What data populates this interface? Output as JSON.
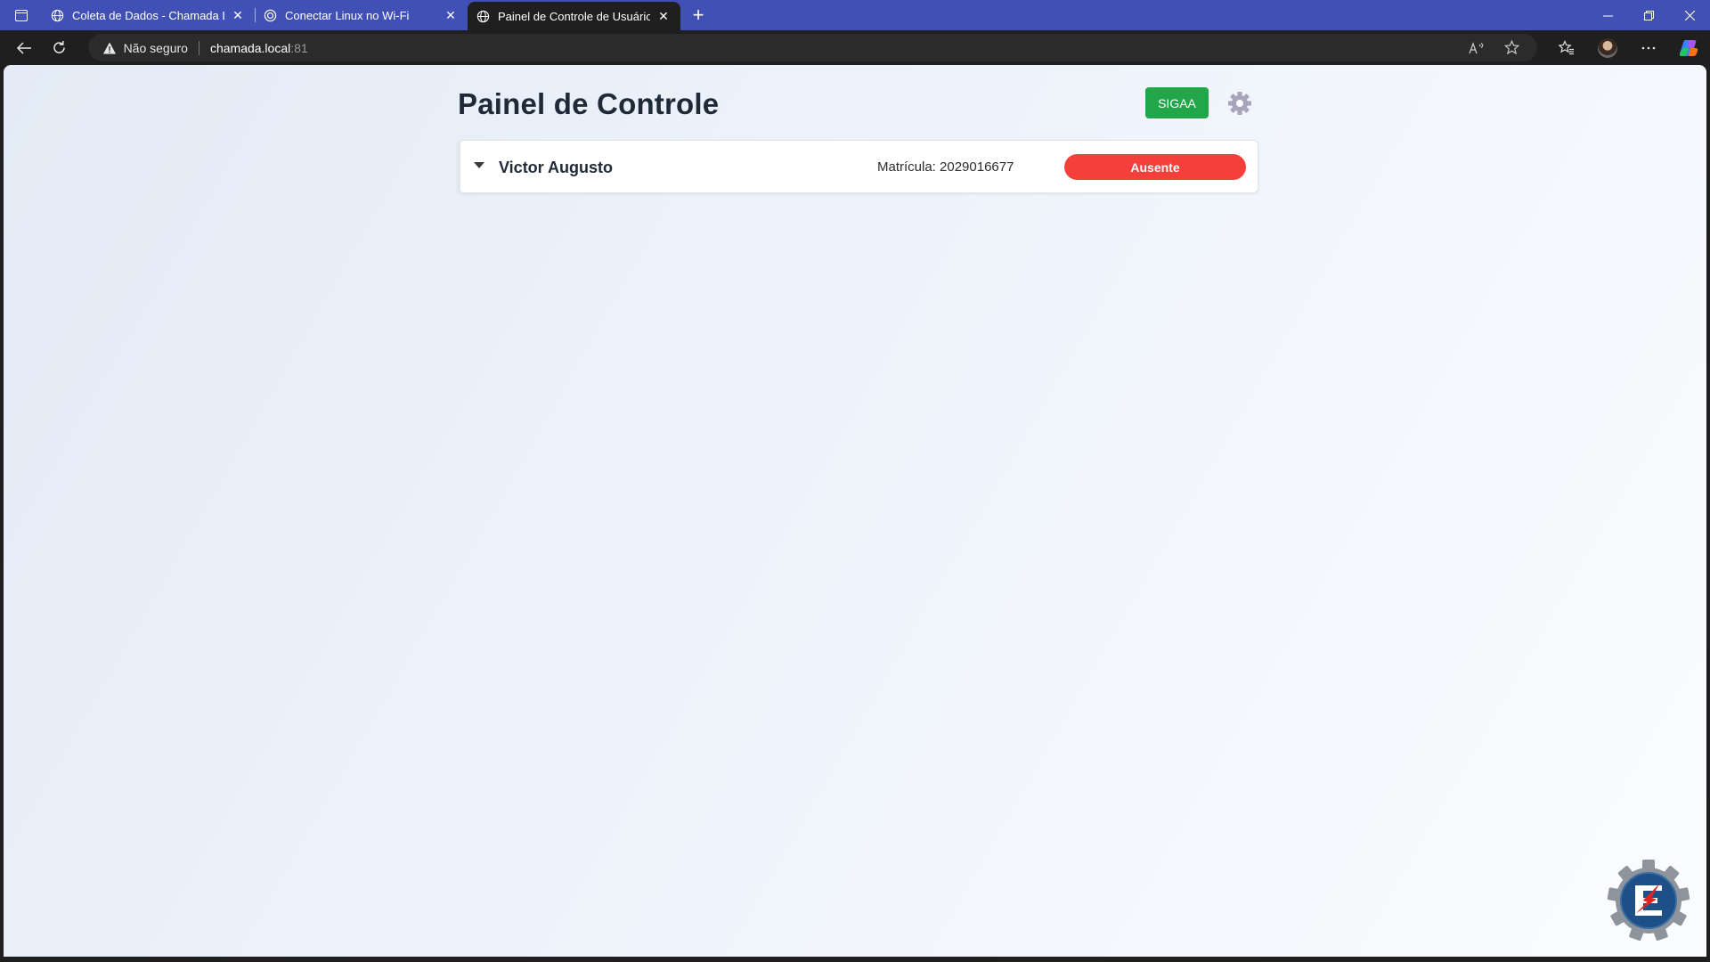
{
  "browser": {
    "tabs": [
      {
        "title": "Coleta de Dados - Chamada Local",
        "favicon": "globe-icon",
        "active": false
      },
      {
        "title": "Conectar Linux no Wi-Fi",
        "favicon": "chatgpt-icon",
        "active": false
      },
      {
        "title": "Painel de Controle de Usuários",
        "favicon": "globe-icon",
        "active": true
      }
    ],
    "new_tab_label": "+",
    "address_bar": {
      "security_label": "Não seguro",
      "host": "chamada.local",
      "port": ":81"
    }
  },
  "page": {
    "title": "Painel de Controle",
    "sigaa_button": "SIGAA",
    "users": [
      {
        "name": "Victor Augusto",
        "matricula": "Matrícula: 2029016677",
        "status": "Ausente"
      }
    ]
  },
  "colors": {
    "tabstrip": "#4150b4",
    "sigaa_green": "#22a64a",
    "absent_red": "#f43f3a",
    "title_text": "#1f2937"
  }
}
